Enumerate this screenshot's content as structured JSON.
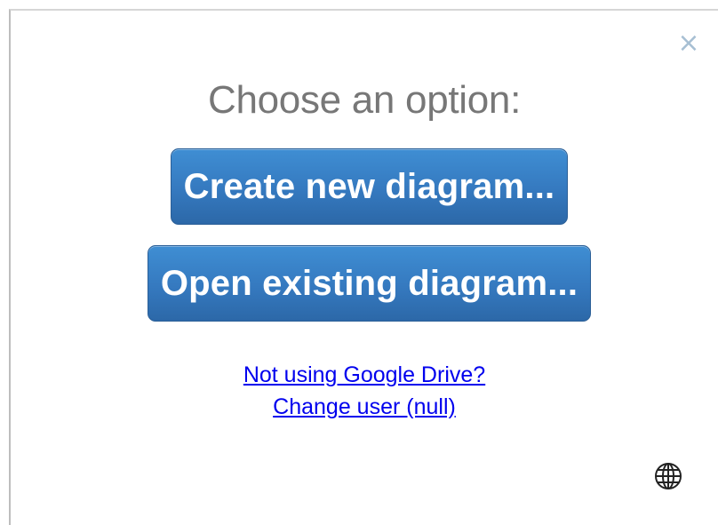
{
  "dialog": {
    "close_label": "×",
    "title": "Choose an option:",
    "create_button_label": "Create new diagram...",
    "open_button_label": "Open existing diagram...",
    "drive_link_label": "Not using Google Drive?",
    "change_user_link_label": "Change user (null)",
    "language_icon": "globe-icon"
  },
  "colors": {
    "button_blue": "#3579bf",
    "title_gray": "#777777",
    "link_blue": "#0000ee",
    "close_gray_blue": "#a7bfd3"
  }
}
